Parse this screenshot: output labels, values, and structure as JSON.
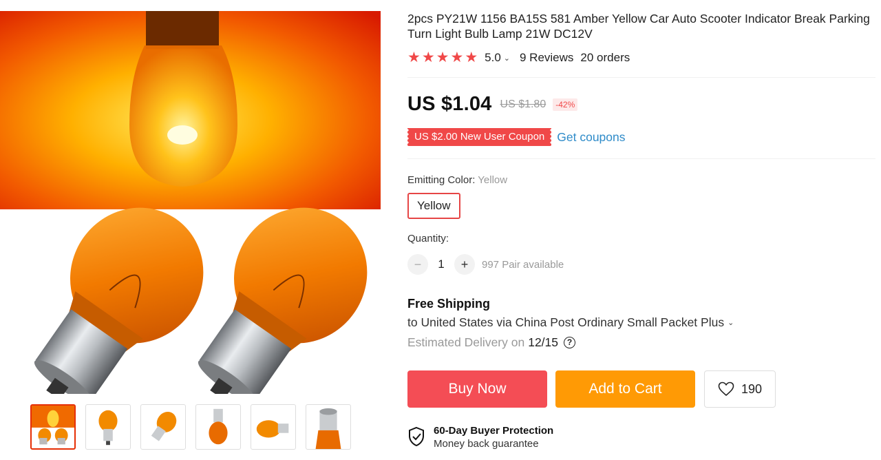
{
  "product": {
    "title": "2pcs PY21W 1156 BA15S 581 Amber Yellow Car Auto Scooter Indicator Break Parking Turn Light Bulb Lamp 21W DC12V",
    "rating": {
      "stars": 5,
      "value": "5.0",
      "reviews": "9 Reviews",
      "orders": "20 orders"
    },
    "price": {
      "current": "US $1.04",
      "original": "US $1.80",
      "discount": "-42%"
    },
    "coupon": {
      "label": "US $2.00 New User Coupon",
      "link": "Get coupons"
    },
    "sku": {
      "label": "Emitting Color: ",
      "selected": "Yellow",
      "options": [
        "Yellow"
      ]
    },
    "quantity": {
      "label": "Quantity:",
      "minus": "−",
      "value": "1",
      "plus": "+",
      "available": "997 Pair available"
    },
    "shipping": {
      "title": "Free Shipping",
      "line": "to United States via China Post Ordinary Small Packet Plus",
      "delivery_label": "Estimated Delivery on",
      "delivery_date": "12/15",
      "help": "?"
    },
    "actions": {
      "buy_now": "Buy Now",
      "add_to_cart": "Add to Cart",
      "wishlist_count": "190"
    },
    "protection": {
      "title": "60-Day Buyer Protection",
      "subtitle": "Money back guarantee"
    }
  },
  "colors": {
    "accent_red": "#f44d55",
    "cart_orange": "#ff9a05",
    "link_blue": "#2e8bc9",
    "star_red": "#f04848"
  },
  "icons": [
    "star-icon",
    "chevron-down-icon",
    "help-circle-icon",
    "heart-icon",
    "shield-check-icon"
  ],
  "thumbnails": [
    "thumbnail-1",
    "thumbnail-2",
    "thumbnail-3",
    "thumbnail-4",
    "thumbnail-5",
    "thumbnail-6"
  ]
}
